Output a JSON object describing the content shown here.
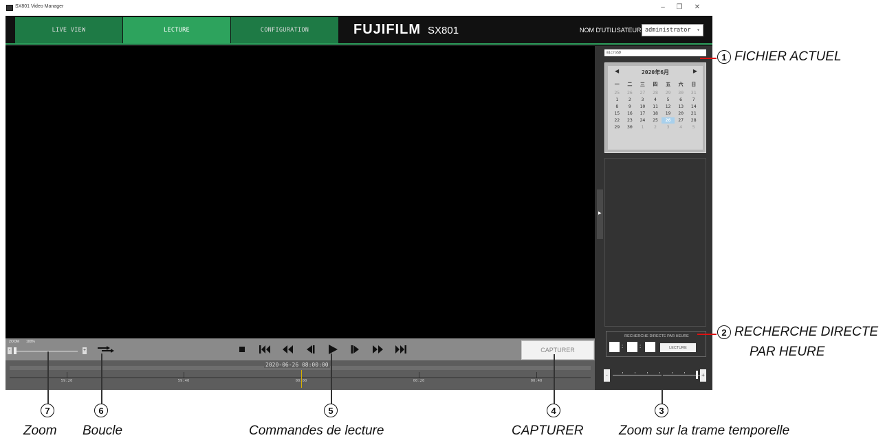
{
  "window": {
    "title": "SX801 Video Manager",
    "minimize": "–",
    "restore": "❐",
    "close": "✕"
  },
  "nav": {
    "tabs": [
      {
        "label": "LIVE VIEW"
      },
      {
        "label": "LECTURE"
      },
      {
        "label": "CONFIGURATION"
      }
    ],
    "brand": "FUJIFILM",
    "model": "SX801",
    "user_label": "NOM D'UTILISATEUR",
    "user_value": "administrator"
  },
  "controls": {
    "zoom_label": "ZOOM",
    "zoom_value": "100%",
    "zoom_minus": "-",
    "zoom_plus": "+",
    "capture_label": "CAPTURER",
    "loop_icon": "loop-arrow-icon",
    "playback_icons": [
      "stop-icon",
      "skip-start-icon",
      "rewind-icon",
      "step-back-icon",
      "play-icon",
      "step-forward-icon",
      "fast-forward-icon",
      "skip-end-icon"
    ]
  },
  "timeline": {
    "current": "2020-06-26 08:00:00",
    "ticks": [
      "59:20",
      "59:40",
      "00:00",
      "00:20",
      "00:40"
    ]
  },
  "sidebar": {
    "file_source": "microSD",
    "calendar": {
      "title": "2020年6月",
      "prev": "◀",
      "next": "▶",
      "weekdays": [
        "一",
        "二",
        "三",
        "四",
        "五",
        "六",
        "日"
      ],
      "days": [
        {
          "d": "25",
          "dim": true
        },
        {
          "d": "26",
          "dim": true
        },
        {
          "d": "27",
          "dim": true
        },
        {
          "d": "28",
          "dim": true
        },
        {
          "d": "29",
          "dim": true
        },
        {
          "d": "30",
          "dim": true
        },
        {
          "d": "31",
          "dim": true
        },
        {
          "d": "1"
        },
        {
          "d": "2"
        },
        {
          "d": "3"
        },
        {
          "d": "4"
        },
        {
          "d": "5"
        },
        {
          "d": "6"
        },
        {
          "d": "7"
        },
        {
          "d": "8"
        },
        {
          "d": "9"
        },
        {
          "d": "10"
        },
        {
          "d": "11"
        },
        {
          "d": "12"
        },
        {
          "d": "13"
        },
        {
          "d": "14"
        },
        {
          "d": "15"
        },
        {
          "d": "16"
        },
        {
          "d": "17"
        },
        {
          "d": "18"
        },
        {
          "d": "19"
        },
        {
          "d": "20"
        },
        {
          "d": "21"
        },
        {
          "d": "22"
        },
        {
          "d": "23"
        },
        {
          "d": "24"
        },
        {
          "d": "25"
        },
        {
          "d": "26",
          "sel": true
        },
        {
          "d": "27"
        },
        {
          "d": "28"
        },
        {
          "d": "29"
        },
        {
          "d": "30"
        },
        {
          "d": "1",
          "dim": true
        },
        {
          "d": "2",
          "dim": true
        },
        {
          "d": "3",
          "dim": true
        },
        {
          "d": "4",
          "dim": true
        },
        {
          "d": "5",
          "dim": true
        }
      ]
    },
    "direct_search": {
      "title": "RECHERCHE DIRECTE PAR HEURE",
      "button": "LECTURE",
      "sep": ":"
    },
    "timeframe_minus": "-",
    "timeframe_plus": "+"
  },
  "annotations": {
    "n1": "1",
    "c1": "FICHIER ACTUEL",
    "n2": "2",
    "c2a": "RECHERCHE DIRECTE",
    "c2b": "PAR HEURE",
    "n3": "3",
    "c3": "Zoom sur la trame temporelle",
    "n4": "4",
    "c4": "CAPTURER",
    "n5": "5",
    "c5": "Commandes de lecture",
    "n6": "6",
    "c6": "Boucle",
    "n7": "7",
    "c7": "Zoom"
  },
  "colors": {
    "accent": "#2c9e5c",
    "callout": "#d11111",
    "cursor": "#d8b000"
  }
}
